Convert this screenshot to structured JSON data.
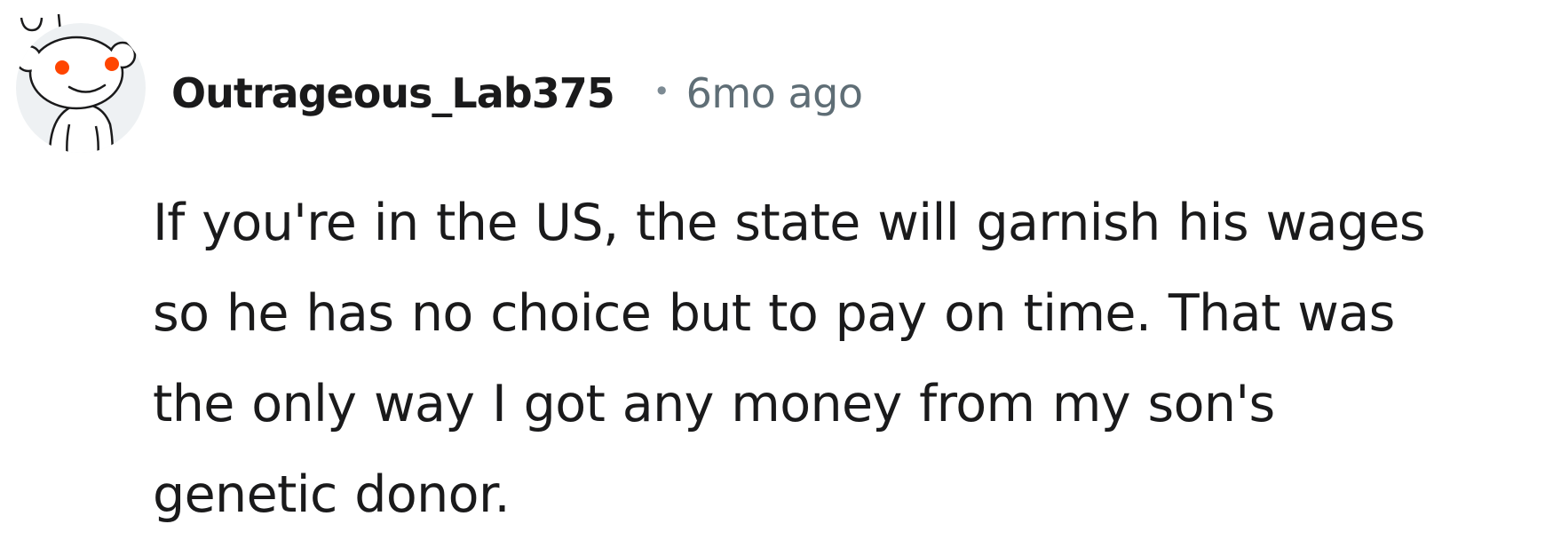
{
  "comment": {
    "author": "Outrageous_Lab375",
    "separator": "•",
    "timestamp": "6mo ago",
    "body_lines": [
      "If you're in the US, the state will garnish his wages",
      "so he has no choice but to pay on time. That was",
      "the only way I got any money from my son's",
      "genetic donor."
    ],
    "avatar_icon": "snoo-avatar-icon",
    "colors": {
      "author": "#1a1a1b",
      "timestamp": "#5f6e76",
      "avatar_eye": "#ff4500",
      "avatar_bg": "#eef1f3"
    }
  }
}
